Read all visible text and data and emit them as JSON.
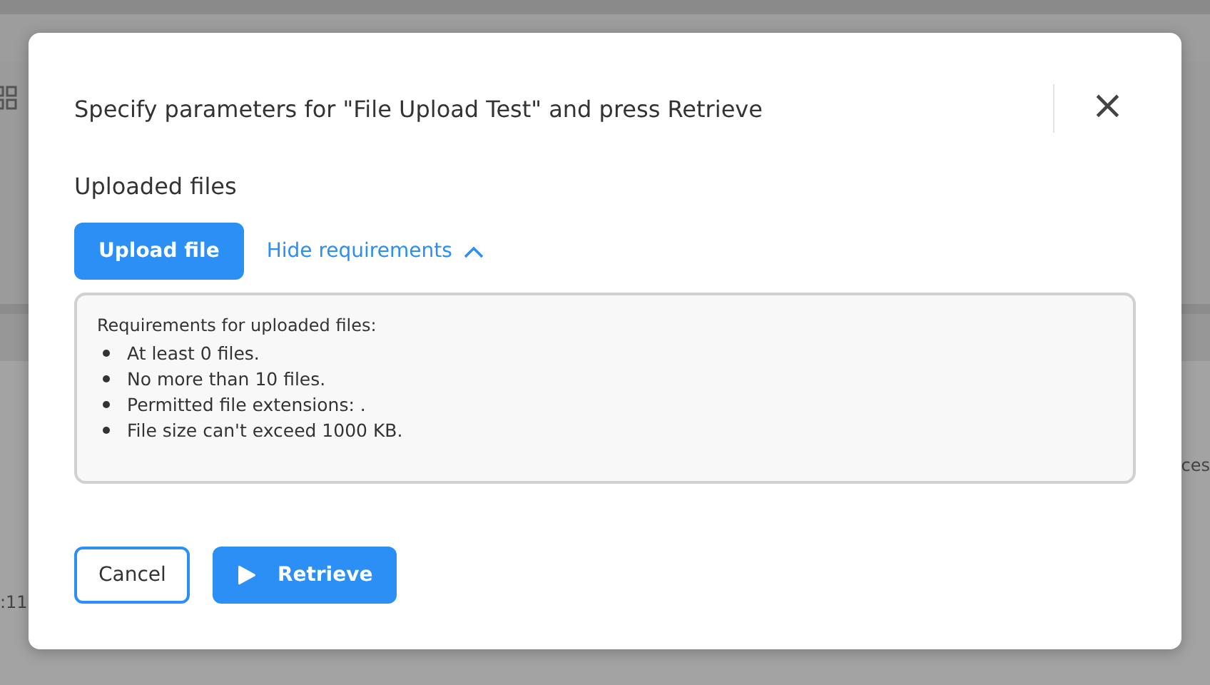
{
  "background": {
    "left_fragment": ":11",
    "right_fragment": "ces"
  },
  "dialog": {
    "title": "Specify parameters for \"File Upload Test\" and press Retrieve",
    "close": "×",
    "section_title": "Uploaded files",
    "upload_button": "Upload file",
    "toggle_link": {
      "label": "Hide requirements",
      "expanded": true
    },
    "requirements": {
      "heading": "Requirements for uploaded files:",
      "items": [
        "At least 0 files.",
        "No more than 10 files.",
        "Permitted file extensions: .",
        "File size can't exceed 1000 KB."
      ]
    },
    "buttons": [
      {
        "label": "Cancel",
        "kind": "secondary"
      },
      {
        "label": "Retrieve",
        "kind": "primary"
      }
    ]
  }
}
